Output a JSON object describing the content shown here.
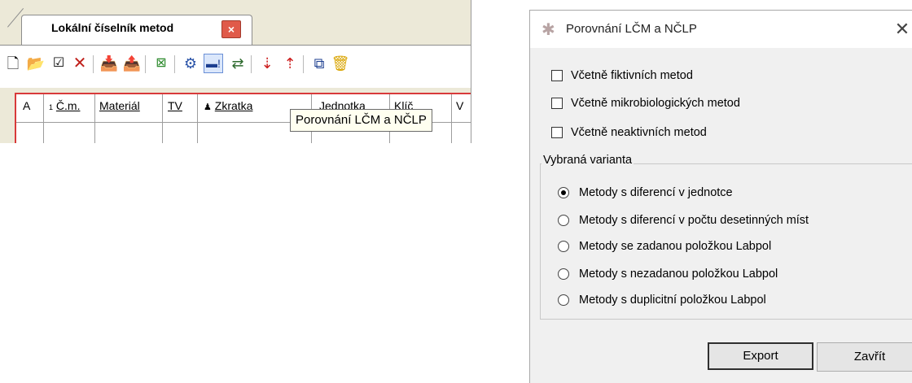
{
  "app": {
    "tab_label": "Lokální číselník metod",
    "tab_close": "×",
    "columns": [
      "A",
      "Č.m.",
      "Materiál",
      "TV",
      "Zkratka",
      "Jednotka",
      "Klíč",
      "V"
    ],
    "tooltip": "Porovnání LČM a NČLP"
  },
  "dialog": {
    "title": "Porovnání LČM a NČLP",
    "close": "✕",
    "checkboxes": [
      "Včetně fiktivních metod",
      "Včetně mikrobiologických metod",
      "Včetně neaktivních metod"
    ],
    "group_label": "Vybraná varianta",
    "options": [
      "Metody s diferencí v jednotce",
      "Metody s diferencí v počtu desetinných míst",
      "Metody se zadanou položkou Labpol",
      "Metody s nezadanou položkou Labpol",
      "Metody s duplicitní položkou Labpol"
    ],
    "selected_option_index": 0,
    "buttons": {
      "export": "Export",
      "close": "Zavřít"
    }
  },
  "colors": {
    "grid_border": "#d83a3a",
    "tab_close_bg": "#e05a4a",
    "tooltip_bg": "#fffff0"
  }
}
